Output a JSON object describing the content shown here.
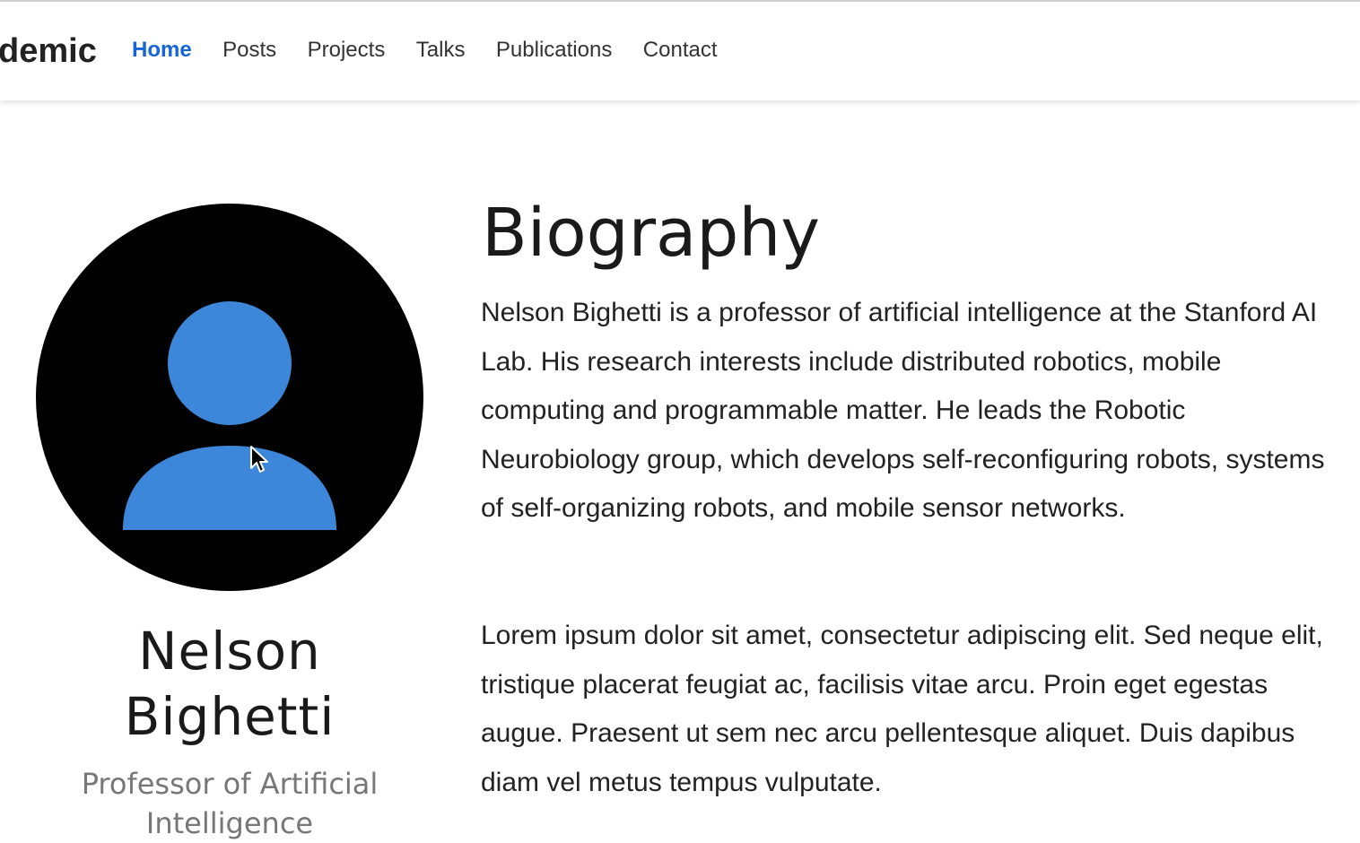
{
  "navbar": {
    "brand": "demic",
    "links": [
      {
        "label": "Home",
        "active": true
      },
      {
        "label": "Posts"
      },
      {
        "label": "Projects"
      },
      {
        "label": "Talks"
      },
      {
        "label": "Publications"
      },
      {
        "label": "Contact"
      }
    ]
  },
  "profile": {
    "name_line1": "Nelson",
    "name_line2": "Bighetti",
    "role": "Professor of Artificial Intelligence",
    "avatar_icon": "user-avatar-icon"
  },
  "biography": {
    "title": "Biography",
    "paragraphs": [
      "Nelson Bighetti is a professor of artificial intelligence at the Stanford AI Lab. His research interests include distributed robotics, mobile computing and programmable matter. He leads the Robotic Neurobiology group, which develops self-reconfiguring robots, systems of self-organizing robots, and mobile sensor networks.",
      "Lorem ipsum dolor sit amet, consectetur adipiscing elit. Sed neque elit, tristique placerat feugiat ac, facilisis vitae arcu. Proin eget egestas augue. Praesent ut sem nec arcu pellentesque aliquet. Duis dapibus diam vel metus tempus vulputate."
    ]
  },
  "colors": {
    "accent": "#1565d8",
    "avatar_bg": "#000000",
    "avatar_figure": "#3d87db"
  }
}
